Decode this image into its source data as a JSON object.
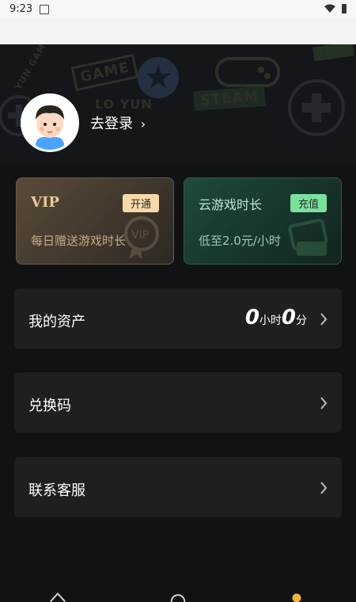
{
  "status_bar": {
    "time": "9:23"
  },
  "profile": {
    "login_label": "去登录",
    "login_chevron": "›"
  },
  "hero_decor": [
    "GAME",
    "STEAM",
    "LIKE",
    "LO YUN",
    "YUN GAME"
  ],
  "cards": {
    "vip": {
      "title": "VIP",
      "button": "开通",
      "subtitle": "每日赠送游戏时长",
      "watermark": "VIP"
    },
    "cloud_time": {
      "title": "云游戏时长",
      "button": "充值",
      "subtitle": "低至2.0元/小时"
    }
  },
  "rows": {
    "assets": {
      "label": "我的资产",
      "hours_value": "0",
      "hours_unit": "小时",
      "minutes_value": "0",
      "minutes_unit": "分"
    },
    "redeem": {
      "label": "兑换码"
    },
    "support": {
      "label": "联系客服"
    }
  },
  "colors": {
    "vip_accent": "#e9c89a",
    "cloud_accent": "#79e19b",
    "tab_active": "#f2b43c"
  }
}
